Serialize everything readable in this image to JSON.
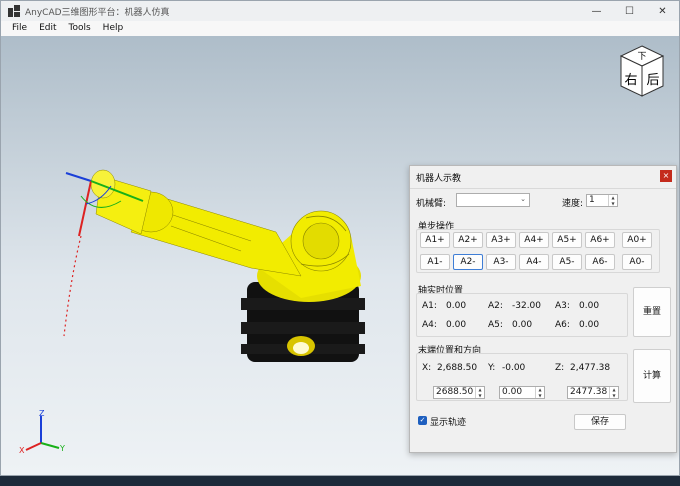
{
  "window": {
    "title": "AnyCAD三维图形平台：机器人仿真",
    "controls": {
      "minimize": "—",
      "maximize": "☐",
      "close": "✕"
    }
  },
  "menu": {
    "items": [
      "File",
      "Edit",
      "Tools",
      "Help"
    ]
  },
  "viewcube": {
    "top": "下",
    "front": "右",
    "side": "后"
  },
  "axes": {
    "z": "Z",
    "y": "Y",
    "x": "X"
  },
  "dialog": {
    "title": "机器人示教",
    "close": "×",
    "arm_label": "机械臂:",
    "arm_value": "",
    "speed_label": "速度:",
    "speed_value": "1",
    "step_group": "单步操作",
    "plus_buttons": [
      "A1+",
      "A2+",
      "A3+",
      "A4+",
      "A5+",
      "A6+",
      "A0+"
    ],
    "minus_buttons": [
      "A1-",
      "A2-",
      "A3-",
      "A4-",
      "A5-",
      "A6-",
      "A0-"
    ],
    "joint_group": "轴实时位置",
    "joints": [
      {
        "label": "A1:",
        "value": "0.00"
      },
      {
        "label": "A2:",
        "value": "-32.00"
      },
      {
        "label": "A3:",
        "value": "0.00"
      },
      {
        "label": "A4:",
        "value": "0.00"
      },
      {
        "label": "A5:",
        "value": "0.00"
      },
      {
        "label": "A6:",
        "value": "0.00"
      }
    ],
    "reset_button": "重置",
    "end_group": "末端位置和方向",
    "end": {
      "x_label": "X:",
      "x_value": "2,688.50",
      "y_label": "Y:",
      "y_value": "-0.00",
      "z_label": "Z:",
      "z_value": "2,477.38"
    },
    "inputs": {
      "x": "2688.50",
      "y": "0.00",
      "z": "2477.38"
    },
    "calc_button": "计算",
    "show_trace_label": "显示轨迹",
    "show_trace_checked": true,
    "save_button": "保存"
  },
  "colors": {
    "robot": "#f2ec00",
    "base": "#111111",
    "close_button": "#c42b1c",
    "focus": "#3f7ed6",
    "checkbox": "#1e5fbf"
  }
}
